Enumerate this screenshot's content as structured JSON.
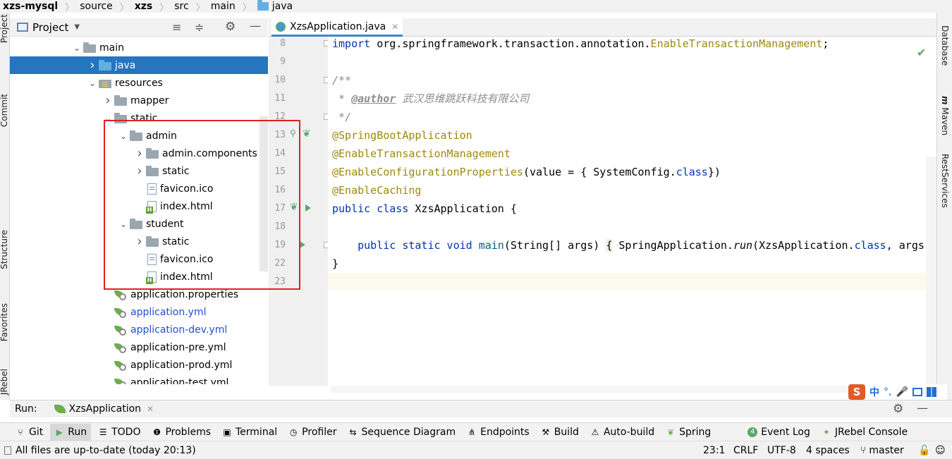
{
  "breadcrumb": [
    "xzs-mysql",
    "source",
    "xzs",
    "src",
    "main",
    "java"
  ],
  "left_stripe": {
    "project": "Project",
    "commit": "Commit",
    "structure": "Structure",
    "favorites": "Favorites",
    "jrebel": "JRebel"
  },
  "right_stripe": {
    "database": "Database",
    "maven": "Maven",
    "rest_services": "RestServices"
  },
  "project_panel": {
    "title": "Project",
    "tree": [
      {
        "label": "main",
        "icon": "folder-icon",
        "arrow": "expanded"
      },
      {
        "label": "java",
        "icon": "source-folder-icon",
        "arrow": "collapsed",
        "selected": true
      },
      {
        "label": "resources",
        "icon": "resources-folder-icon",
        "arrow": "expanded"
      },
      {
        "label": "mapper",
        "icon": "folder-icon",
        "arrow": "collapsed"
      },
      {
        "label": "static",
        "icon": "folder-icon",
        "arrow": "expanded"
      },
      {
        "label": "admin",
        "icon": "folder-icon",
        "arrow": "expanded"
      },
      {
        "label": "admin.components",
        "icon": "folder-icon",
        "arrow": "collapsed"
      },
      {
        "label": "static",
        "icon": "folder-icon",
        "arrow": "collapsed"
      },
      {
        "label": "favicon.ico",
        "icon": "image-file-icon",
        "arrow": "none"
      },
      {
        "label": "index.html",
        "icon": "html-file-icon",
        "arrow": "none"
      },
      {
        "label": "student",
        "icon": "folder-icon",
        "arrow": "expanded"
      },
      {
        "label": "static",
        "icon": "folder-icon",
        "arrow": "collapsed"
      },
      {
        "label": "favicon.ico",
        "icon": "image-file-icon",
        "arrow": "none"
      },
      {
        "label": "index.html",
        "icon": "html-file-icon",
        "arrow": "none"
      },
      {
        "label": "application.properties",
        "icon": "spring-config-icon",
        "arrow": "none"
      },
      {
        "label": "application.yml",
        "icon": "spring-config-icon",
        "arrow": "none",
        "blue": true
      },
      {
        "label": "application-dev.yml",
        "icon": "spring-config-icon",
        "arrow": "none",
        "blue": true
      },
      {
        "label": "application-pre.yml",
        "icon": "spring-config-icon",
        "arrow": "none"
      },
      {
        "label": "application-prod.yml",
        "icon": "spring-config-icon",
        "arrow": "none"
      },
      {
        "label": "application-test.yml",
        "icon": "spring-config-icon",
        "arrow": "none"
      }
    ]
  },
  "editor": {
    "tab_label": "XzsApplication.java",
    "line_numbers": [
      "8",
      "9",
      "10",
      "11",
      "12",
      "13",
      "14",
      "15",
      "16",
      "17",
      "18",
      "19",
      "22",
      "23"
    ],
    "code": {
      "l8_kw": "import",
      "l8_pkg": " org.springframework.transaction.annotation.",
      "l8_ann": "EnableTransactionManagement",
      "l8_end": ";",
      "l10": "/**",
      "l11_star": " * ",
      "l11_tag": "@author",
      "l11_text": " 武汉思维跳跃科技有限公司",
      "l12": " */",
      "l13": "@SpringBootApplication",
      "l14": "@EnableTransactionManagement",
      "l15_ann": "@EnableConfigurationProperties",
      "l15_a": "(value = { SystemConfig.",
      "l15_kw": "class",
      "l15_b": "})",
      "l16": "@EnableCaching",
      "l17_kw": "public class",
      "l17_name": " XzsApplication {",
      "l19_kw": "public static void",
      "l19_fn": "main",
      "l19_a": "(String[] args) ",
      "l19_brace": "{",
      "l19_b": " SpringApplication.",
      "l19_run": "run",
      "l19_c": "(XzsApplication.",
      "l19_kw2": "class",
      "l19_d": ", args);",
      "l22": "}"
    }
  },
  "run_panel": {
    "label": "Run:",
    "config": "XzsApplication"
  },
  "ime": {
    "s": "S",
    "cn": "中",
    "punct": "°,"
  },
  "tool_windows": [
    "Git",
    "Run",
    "TODO",
    "Problems",
    "Terminal",
    "Profiler",
    "Sequence Diagram",
    "Endpoints",
    "Build",
    "Auto-build",
    "Spring",
    "Event Log",
    "JRebel Console"
  ],
  "event_log_count": "4",
  "status": {
    "message": "All files are up-to-date (today 20:13)",
    "position": "23:1",
    "line_sep": "CRLF",
    "encoding": "UTF-8",
    "indent": "4 spaces",
    "branch": "master"
  },
  "colors": {
    "selection": "#2675bf",
    "highlight_box": "#e02020",
    "annotation": "#9e880d",
    "keyword": "#0033b3"
  }
}
